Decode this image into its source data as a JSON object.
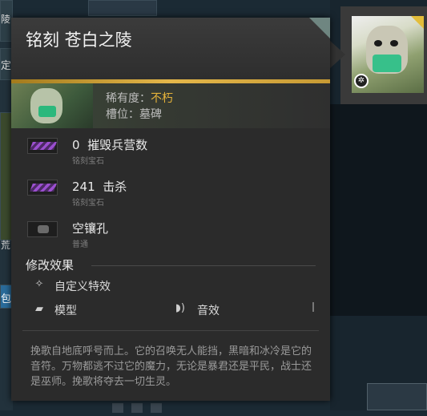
{
  "background": {
    "left_fragments": [
      "陵",
      "定",
      "荒",
      "包"
    ]
  },
  "tooltip": {
    "title": "铭刻 苍白之陵",
    "rarity_label": "稀有度：",
    "rarity_value": "不朽",
    "slot_label": "槽位：",
    "slot_value": "墓碑",
    "rarity_color": "#e4b23a",
    "gems": [
      {
        "count": "0",
        "name": "摧毁兵营数",
        "type": "铭刻宝石",
        "icon": "inscribed-gem-icon"
      },
      {
        "count": "241",
        "name": "击杀",
        "type": "铭刻宝石",
        "icon": "inscribed-gem-icon"
      },
      {
        "count": "",
        "name": "空镶孔",
        "type": "普通",
        "icon": "empty-socket-icon"
      }
    ],
    "modifiers_title": "修改效果",
    "modifiers": {
      "custom_effect": "自定义特效",
      "model": "模型",
      "sound": "音效"
    },
    "description": "挽歌自地底呼号而上。它的召唤无人能挡，黑暗和冰冷是它的音符。万物都逃不过它的魔力，无论是暴君还是平民，战士还是巫师。挽歌将夺去一切生灵。"
  },
  "item_preview": {
    "icon": "skull-tombstone-icon",
    "badge_icon": "gear-badge-icon"
  }
}
